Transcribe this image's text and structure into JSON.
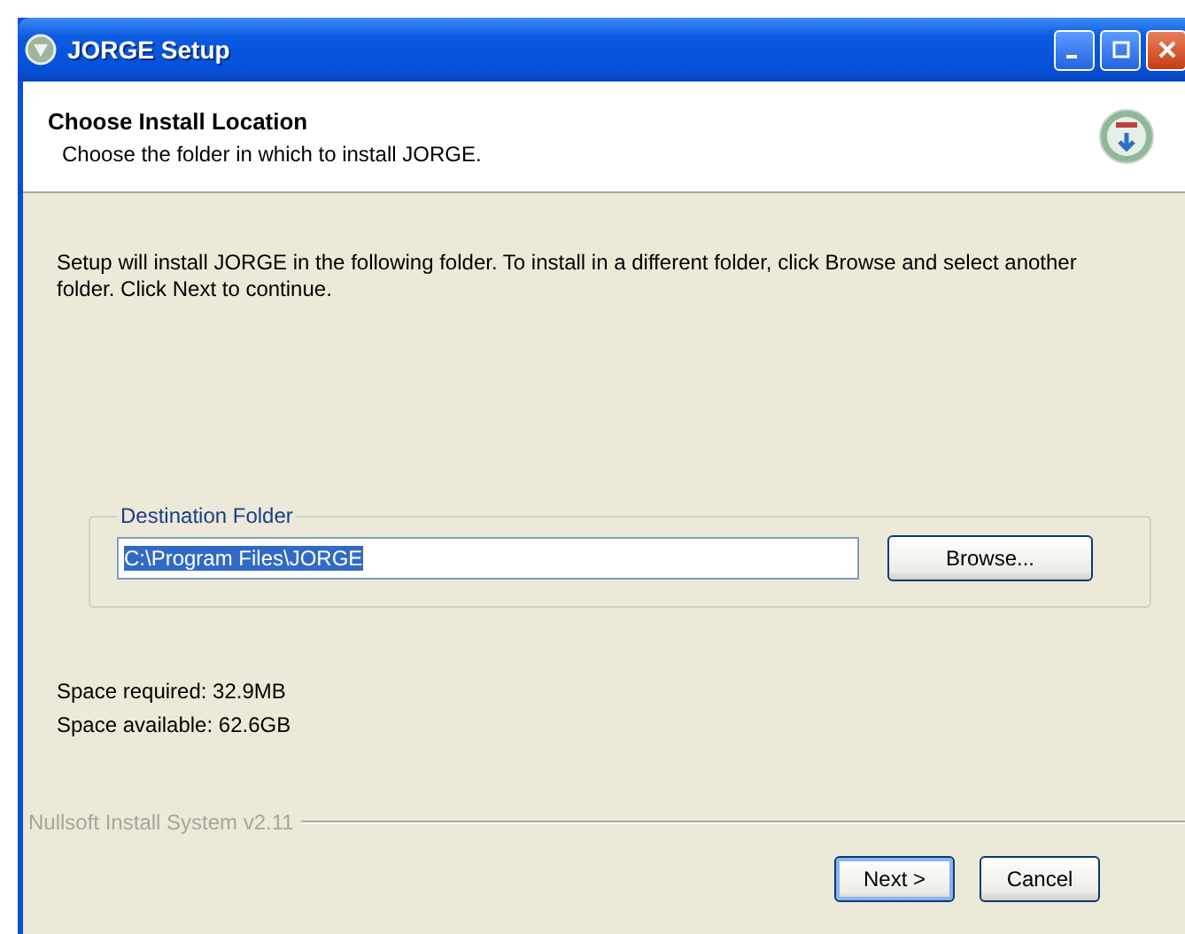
{
  "window": {
    "title": "JORGE Setup"
  },
  "header": {
    "title": "Choose Install Location",
    "subtitle": "Choose the folder in which to install JORGE."
  },
  "intro": "Setup will install JORGE in the following folder. To install in a different folder, click Browse and select another folder. Click Next to continue.",
  "destination": {
    "label": "Destination Folder",
    "value": "C:\\Program Files\\JORGE",
    "text_selected": true,
    "browse_button": "Browse..."
  },
  "space": [
    "Space required: 32.9MB",
    "Space available: 62.6GB"
  ],
  "branding": "Nullsoft Install System v2.11",
  "buttons": [
    {
      "label": "Next >",
      "default": true
    },
    {
      "label": "Cancel",
      "default": false
    }
  ]
}
